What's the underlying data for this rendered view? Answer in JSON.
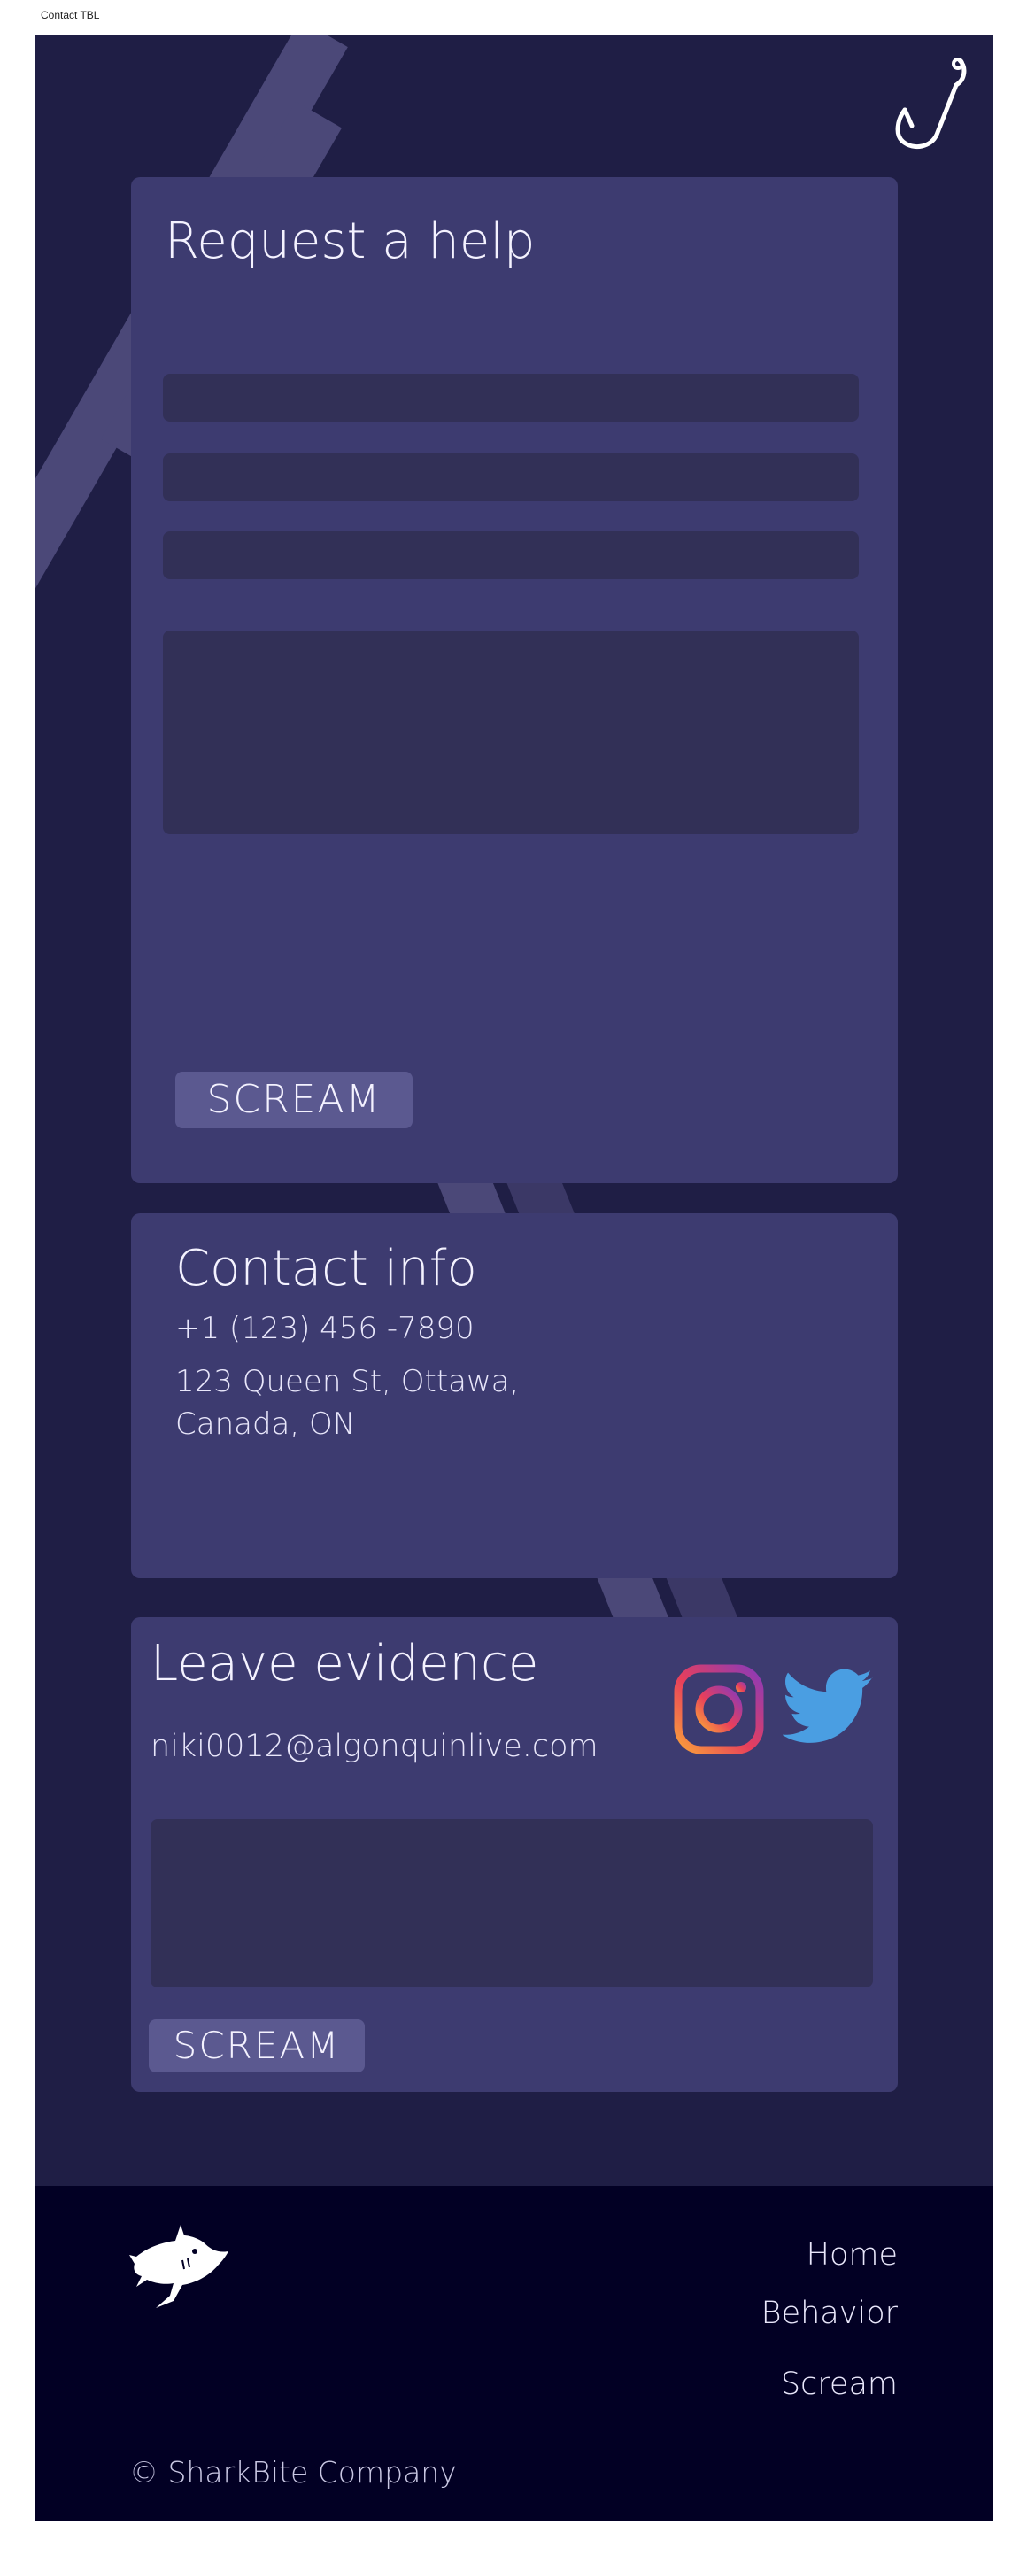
{
  "tab": {
    "label": "Contact TBL"
  },
  "colors": {
    "background": "#1f1e45",
    "card": "#3d3b70",
    "field": "#323057",
    "button": "#5b5990",
    "footer": "#020024",
    "text": "#f4f2ff",
    "twitter": "#4a9ee2"
  },
  "icons": {
    "hook": "fish-hook-icon",
    "instagram": "instagram-icon",
    "twitter": "twitter-icon",
    "logo": "shark-logo-icon"
  },
  "help_form": {
    "title": "Request a help",
    "fields": [
      "",
      "",
      "",
      ""
    ],
    "submit_label": "SCREAM"
  },
  "contact": {
    "title": "Contact info",
    "phone": "+1 (123) 456 -7890",
    "address": "123 Queen St, Ottawa, Canada, ON"
  },
  "evidence": {
    "title": "Leave evidence",
    "email": "niki0012@algonquinlive.com",
    "submit_label": "SCREAM"
  },
  "footer": {
    "nav": [
      "Home",
      "Behavior",
      "Scream"
    ],
    "copyright": "© SharkBite Company"
  }
}
